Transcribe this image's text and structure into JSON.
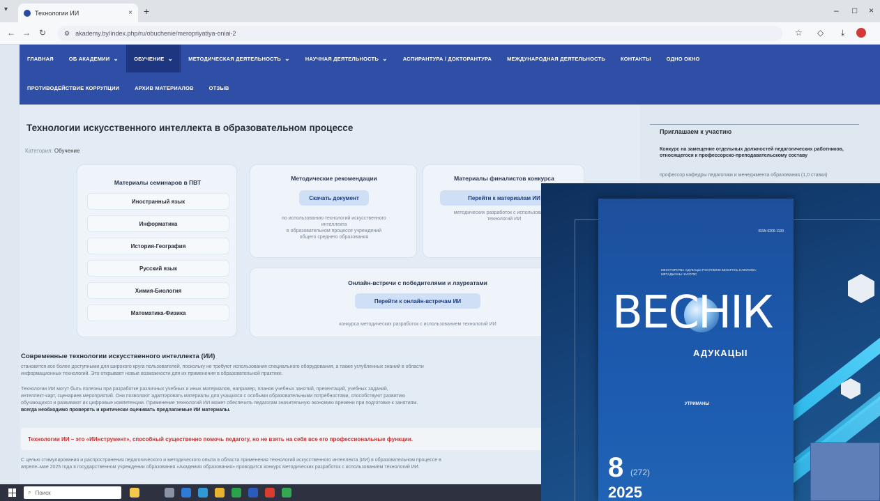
{
  "browser": {
    "tab_title": "Технологии ИИ",
    "tab_close": "×",
    "new_tab": "+",
    "url": "akademy.by/index.php/ru/obuchenie/meropriyatiya-oniai-2",
    "minimize": "–",
    "maximize": "□",
    "close": "×"
  },
  "nav": {
    "row1": [
      {
        "label": "ГЛАВНАЯ",
        "caret": false,
        "active": false
      },
      {
        "label": "ОБ АКАДЕМИИ",
        "caret": true,
        "active": false
      },
      {
        "label": "ОБУЧЕНИЕ",
        "caret": true,
        "active": true
      },
      {
        "label": "МЕТОДИЧЕСКАЯ ДЕЯТЕЛЬНОСТЬ",
        "caret": true,
        "active": false
      },
      {
        "label": "НАУЧНАЯ ДЕЯТЕЛЬНОСТЬ",
        "caret": true,
        "active": false
      },
      {
        "label": "АСПИРАНТУРА / ДОКТОРАНТУРА",
        "caret": false,
        "active": false
      },
      {
        "label": "МЕЖДУНАРОДНАЯ ДЕЯТЕЛЬНОСТЬ",
        "caret": false,
        "active": false
      },
      {
        "label": "КОНТАКТЫ",
        "caret": false,
        "active": false
      },
      {
        "label": "ОДНО ОКНО",
        "caret": false,
        "active": false
      }
    ],
    "row2": [
      {
        "label": "ПРОТИВОДЕЙСТВИЕ КОРРУПЦИИ"
      },
      {
        "label": "АРХИВ МАТЕРИАЛОВ"
      },
      {
        "label": "ОТЗЫВ"
      }
    ]
  },
  "page": {
    "title": "Технологии искусственного интеллекта в образовательном процессе",
    "category_label": "Категория:",
    "category_value": "Обучение",
    "seminars": {
      "title": "Материалы семинаров в ПВТ",
      "subjects": [
        "Иностранный язык",
        "Информатика",
        "История-География",
        "Русский язык",
        "Химия-Биология",
        "Математика-Физика"
      ]
    },
    "methodical": {
      "title": "Методические рекомендации",
      "button": "Скачать документ",
      "desc_lines": [
        "по использованию технологий искусственного",
        "интеллекта",
        "в образовательном процессе учреждений",
        "общего среднего образования"
      ]
    },
    "finalists": {
      "title": "Материалы финалистов конкурса",
      "button": "Перейти к материалам ИИ",
      "desc_lines": [
        "методических разработок с использованием",
        "технологий ИИ"
      ]
    },
    "meetings": {
      "title": "Онлайн-встречи с победителями и лауреатами",
      "button": "Перейти к онлайн-встречам ИИ",
      "desc": "конкурса методических разработок с использованием технологий ИИ"
    },
    "section_title": "Современные технологии искусственного интеллекта (ИИ)",
    "para1": [
      "становятся все более доступными для широкого круга пользователей, поскольку не требуют использования специального оборудования, а также углубленных знаний в области",
      "информационных технологий. Это открывает новые возможности для их применения в образовательной практике."
    ],
    "para2": [
      "Технологии ИИ могут быть полезны при разработке различных учебных и иных материалов, например, планов учебных занятий, презентаций, учебных заданий,",
      "интеллект-карт, сценариев мероприятий. Они позволяют адаптировать материалы для учащихся с особыми образовательными потребностями, способствуют развитию",
      "обучающихся и развивают их цифровые компетенции. Применение технологий ИИ может обеспечить педагогам значительную экономию времени при подготовке к занятиям."
    ],
    "para2_bold": "всегда необходимо проверять и критически оценивать предлагаемые ИИ материалы.",
    "alert": "Технологии ИИ – это «ИИнструмент», способный существенно помочь педагогу, но не взять на себя все его профессиональные функции.",
    "para3": [
      "С целью стимулирования и распространения педагогического и методического опыта в области применения технологий искусственного интеллекта (ИИ) в образовательном процессе в",
      "апреле–мае 2025 года в государственном учреждении образования «Академия образования» проводится конкурс методических разработок с использованием технологий ИИ."
    ]
  },
  "sidebar": {
    "heading": "Приглашаем к участию",
    "text_bold": "Конкурс на замещение отдельных должностей педагогических работников, относящегося к профессорско-преподавательскому составу",
    "text_normal": "профессор кафедры педагогики и менеджмента образования (1,0 ставки)"
  },
  "taskbar": {
    "search_placeholder": "Поиск"
  },
  "magazine": {
    "issn": "ISSN 0206-1139",
    "ministry": "МІНІСТЭРСТВА АДУКАЦЫІ РЭСПУБЛІКІ БЕЛАРУСЬ НАВУКОВА-МЕТАДЫЧНЫ ЧАСОПІС",
    "title": "ВЕСНІК",
    "subtitle": "АДУКАЦЫІ",
    "contents_head": "УТРИМАНЫ",
    "number": "8",
    "number_sub": "(272)",
    "year": "2025"
  },
  "colors": {
    "nav_bg": "#2f4fa6",
    "nav_active": "#1e3680",
    "page_bg": "#dfe8f1",
    "card_bg": "#eef4fa",
    "button_bg": "#cfe0f6",
    "alert_text": "#c23232",
    "magazine_bg": "#0e2f5c"
  }
}
